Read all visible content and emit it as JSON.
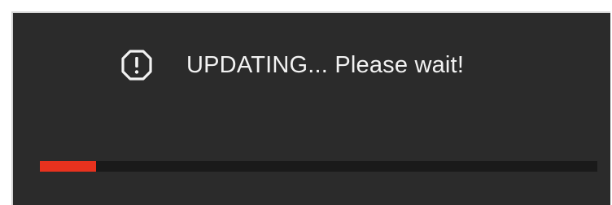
{
  "dialog": {
    "message": "UPDATING... Please wait!",
    "icon": "warning-octagon-icon",
    "progress_percent": 10
  },
  "colors": {
    "background": "#2b2b2b",
    "text": "#f2f2f2",
    "progress_fill": "#e8321e",
    "progress_track": "#1a1a1a",
    "border": "#d6d6d6"
  }
}
